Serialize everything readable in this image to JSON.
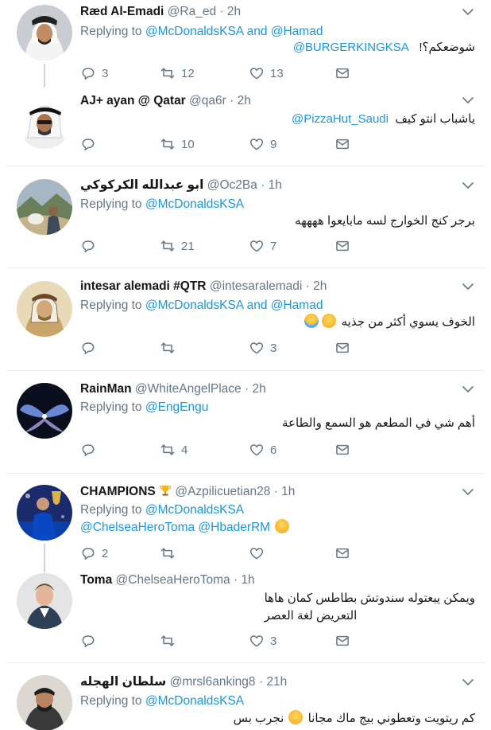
{
  "tweets": [
    {
      "name": "Ræd Al-Emadi",
      "handle": "@Ra_ed",
      "time": "2h",
      "reply_prefix": "Replying to",
      "reply_targets": "@McDonaldsKSA and @Hamad",
      "body_text": "شوضعكم؟!",
      "body_mention": "@BURGERKINGKSA",
      "counts": {
        "reply": "3",
        "retweet": "12",
        "like": "13"
      }
    },
    {
      "name": "AJ+ ayan @ Qatar",
      "handle": "@qa6r",
      "time": "2h",
      "body_text": "ياشباب انتو كيف",
      "body_mention": "@PizzaHut_Saudi",
      "counts": {
        "reply": "",
        "retweet": "10",
        "like": "9"
      }
    },
    {
      "name": "ابو عبدالله الكركوكي",
      "handle": "@Oc2Ba",
      "time": "1h",
      "reply_prefix": "Replying to",
      "reply_targets": "@McDonaldsKSA",
      "body_text": "برجر كنج الخوارج لسه مابايعوا ههههه",
      "counts": {
        "reply": "",
        "retweet": "21",
        "like": "7"
      }
    },
    {
      "name": "intesar alemadi #QTR",
      "handle": "@intesaralemadi",
      "time": "2h",
      "reply_prefix": "Replying to",
      "reply_targets": "@McDonaldsKSA and @Hamad",
      "body_text": "الخوف يسوي أكثر من جذيه",
      "emojis": [
        "rofl-emoji",
        "tears-of-joy-emoji"
      ],
      "counts": {
        "reply": "",
        "retweet": "",
        "like": "3"
      }
    },
    {
      "name": "RainMan",
      "handle": "@WhiteAngelPlace",
      "time": "2h",
      "reply_prefix": "Replying to",
      "reply_targets": "@EngEngu",
      "body_text": "أهم شي في المطعم هو السمع والطاعة",
      "counts": {
        "reply": "",
        "retweet": "4",
        "like": "6"
      }
    },
    {
      "name": "CHAMPIONS",
      "name_emoji": "trophy-emoji",
      "handle": "@Azpilicuetian28",
      "time": "1h",
      "reply_prefix": "Replying to",
      "reply_targets": "@McDonaldsKSA",
      "body_mentions": "@ChelseaHeroToma @HbaderRM",
      "body_emoji": "hushed-face-emoji",
      "counts": {
        "reply": "2",
        "retweet": "",
        "like": ""
      }
    },
    {
      "name": "Toma",
      "handle": "@ChelseaHeroToma",
      "time": "1h",
      "body_line1": "ويمكن يبعتوله سندوتش بطاطس كمان هاها",
      "body_line2": "التعريض لغة العصر",
      "counts": {
        "reply": "",
        "retweet": "",
        "like": "3"
      }
    },
    {
      "name": "سلطان الهجله",
      "handle": "@mrsl6anking8",
      "time": "21h",
      "reply_prefix": "Replying to",
      "reply_targets": "@McDonaldsKSA",
      "body_text_a": "كم ريتويت وتعطوني بيج ماك مجانا",
      "body_emoji": "eye-roll-emoji",
      "body_text_b": "نجرب بس",
      "counts": {
        "reply": "",
        "retweet": "",
        "like": ""
      }
    }
  ],
  "colors": {
    "link": "#1b95e0",
    "muted": "#657786",
    "separator": "#e6ecf0"
  }
}
